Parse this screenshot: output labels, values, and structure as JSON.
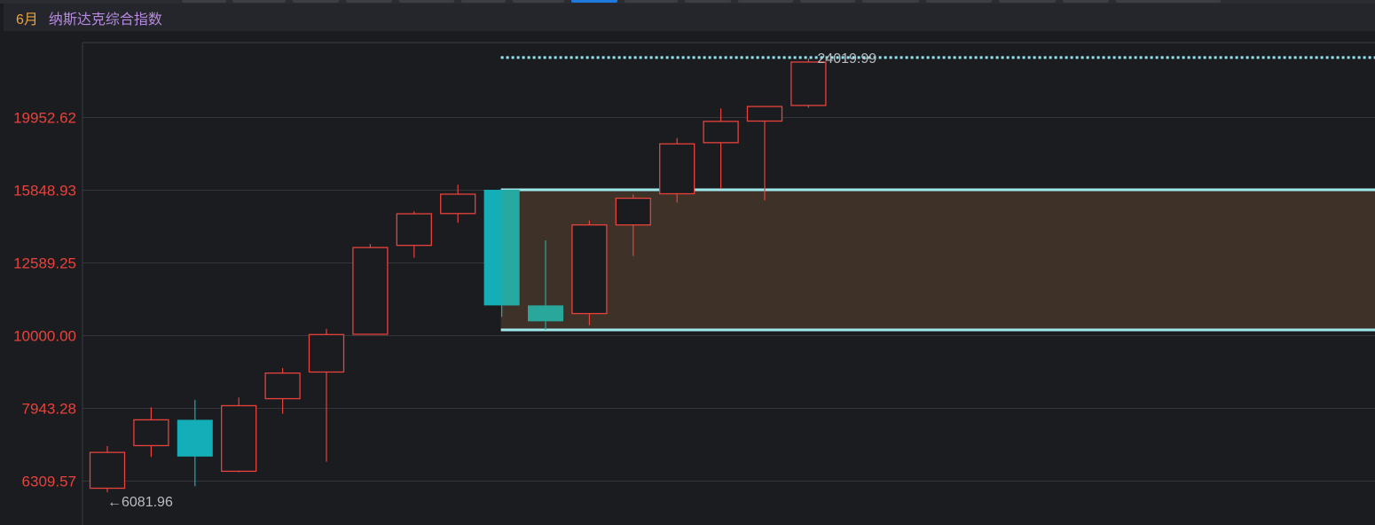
{
  "header": {
    "period": "6月",
    "index_name": "纳斯达克综合指数"
  },
  "colors": {
    "background": "#1b1c20",
    "header_bg": "#24262b",
    "grid": "#33363b",
    "axis_label": "#e8423c",
    "up": "#e8423c",
    "down": "#14aeb8",
    "down_alt": "#2aa79b",
    "box_fill": "#3e3127",
    "box_line": "#9fe8ec",
    "max_line": "#8ee7ee",
    "annotation": "#b9bcc2",
    "period_text": "#e9a33c",
    "name_text": "#b589e0",
    "active_tab": "#1f7ae0"
  },
  "chart_data": {
    "type": "candlestick",
    "scale": "log",
    "ylim": [
      5400,
      27000
    ],
    "yticks": [
      6309.57,
      7943.28,
      10000.0,
      12589.25,
      15848.93,
      19952.62
    ],
    "ytick_labels": [
      "6309.57",
      "7943.28",
      "10000.00",
      "12589.25",
      "15848.93",
      "19952.62"
    ],
    "candles": [
      {
        "open": 6160,
        "high": 7040,
        "low": 6081.96,
        "close": 6900
      },
      {
        "open": 7050,
        "high": 7960,
        "low": 6800,
        "close": 7650
      },
      {
        "open": 7650,
        "high": 8150,
        "low": 6200,
        "close": 6810
      },
      {
        "open": 6500,
        "high": 8210,
        "low": 6480,
        "close": 8000
      },
      {
        "open": 8180,
        "high": 9010,
        "low": 7800,
        "close": 8870
      },
      {
        "open": 8900,
        "high": 10200,
        "low": 6700,
        "close": 10020
      },
      {
        "open": 10030,
        "high": 13350,
        "low": 10030,
        "close": 13200
      },
      {
        "open": 13290,
        "high": 14800,
        "low": 12780,
        "close": 14690
      },
      {
        "open": 14700,
        "high": 16100,
        "low": 14270,
        "close": 15630
      },
      {
        "open": 15850,
        "high": 15850,
        "low": 10600,
        "close": 10990
      },
      {
        "open": 10990,
        "high": 13500,
        "low": 10170,
        "close": 10450
      },
      {
        "open": 10710,
        "high": 14380,
        "low": 10320,
        "close": 14180
      },
      {
        "open": 14180,
        "high": 15620,
        "low": 12850,
        "close": 15430
      },
      {
        "open": 15650,
        "high": 18670,
        "low": 15220,
        "close": 18330
      },
      {
        "open": 18400,
        "high": 20500,
        "low": 15900,
        "close": 19680
      },
      {
        "open": 19700,
        "high": 20650,
        "low": 15330,
        "close": 20630
      },
      {
        "open": 20700,
        "high": 24019.99,
        "low": 20550,
        "close": 23750
      }
    ],
    "box": {
      "top": 15850,
      "bottom": 10170,
      "from_index": 9
    },
    "max_line": {
      "value": 24019.99,
      "from_index": 9
    },
    "annotations": {
      "high": "24019.99",
      "low": "←6081.96"
    }
  }
}
